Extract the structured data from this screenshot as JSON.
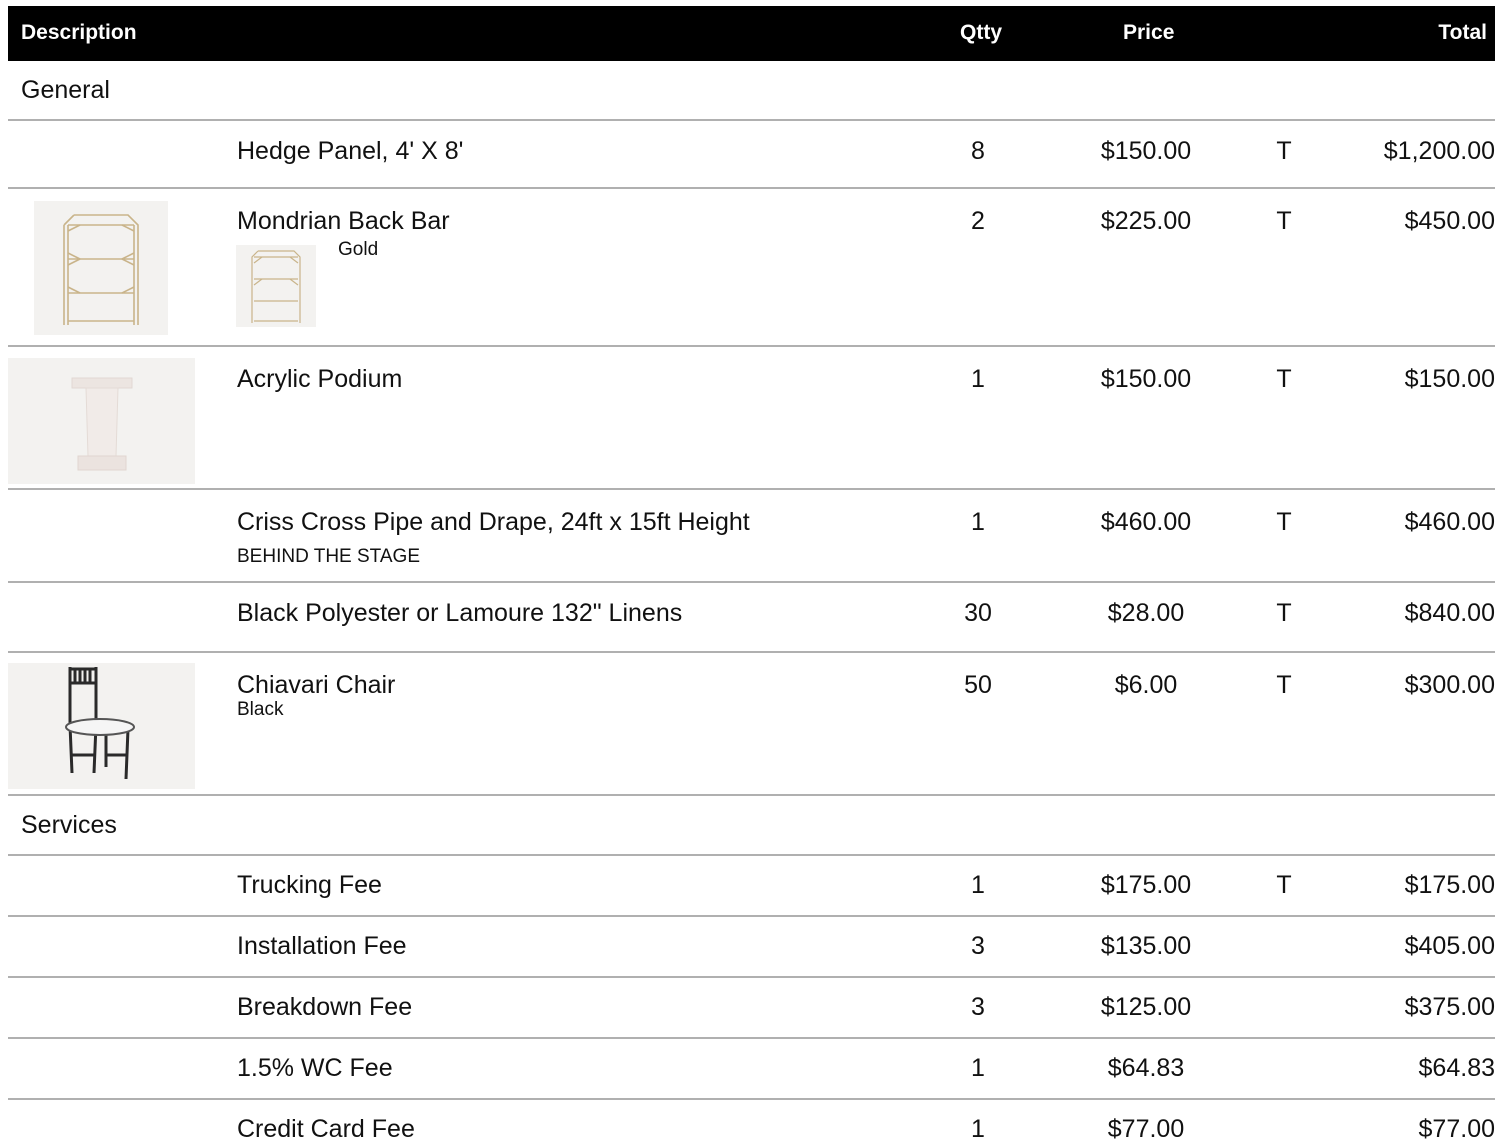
{
  "header": {
    "description": "Description",
    "qty": "Qtty",
    "price": "Price",
    "total": "Total"
  },
  "sections": [
    {
      "label": "General",
      "rows": [
        {
          "desc": "Hedge Panel, 4' X 8'",
          "qty": "8",
          "price": "$150.00",
          "tax": "T",
          "total": "$1,200.00"
        },
        {
          "desc": "Mondrian Back Bar",
          "variant": "Gold",
          "qty": "2",
          "price": "$225.00",
          "tax": "T",
          "total": "$450.00",
          "image": "back-bar-image"
        },
        {
          "desc": "Acrylic Podium",
          "qty": "1",
          "price": "$150.00",
          "tax": "T",
          "total": "$150.00",
          "image": "podium-image"
        },
        {
          "desc": "Criss Cross Pipe and Drape, 24ft x 15ft Height",
          "note": "BEHIND THE STAGE",
          "qty": "1",
          "price": "$460.00",
          "tax": "T",
          "total": "$460.00"
        },
        {
          "desc": "Black Polyester or Lamoure 132\" Linens",
          "qty": "30",
          "price": "$28.00",
          "tax": "T",
          "total": "$840.00"
        },
        {
          "desc": "Chiavari Chair",
          "note": "Black",
          "qty": "50",
          "price": "$6.00",
          "tax": "T",
          "total": "$300.00",
          "image": "chair-image"
        }
      ]
    },
    {
      "label": "Services",
      "rows": [
        {
          "desc": "Trucking Fee",
          "qty": "1",
          "price": "$175.00",
          "tax": "T",
          "total": "$175.00"
        },
        {
          "desc": "Installation Fee",
          "qty": "3",
          "price": "$135.00",
          "tax": "",
          "total": "$405.00"
        },
        {
          "desc": "Breakdown Fee",
          "qty": "3",
          "price": "$125.00",
          "tax": "",
          "total": "$375.00"
        },
        {
          "desc": "1.5% WC Fee",
          "qty": "1",
          "price": "$64.83",
          "tax": "",
          "total": "$64.83"
        },
        {
          "desc": "Credit Card Fee",
          "qty": "1",
          "price": "$77.00",
          "tax": "",
          "total": "$77.00"
        }
      ]
    }
  ]
}
